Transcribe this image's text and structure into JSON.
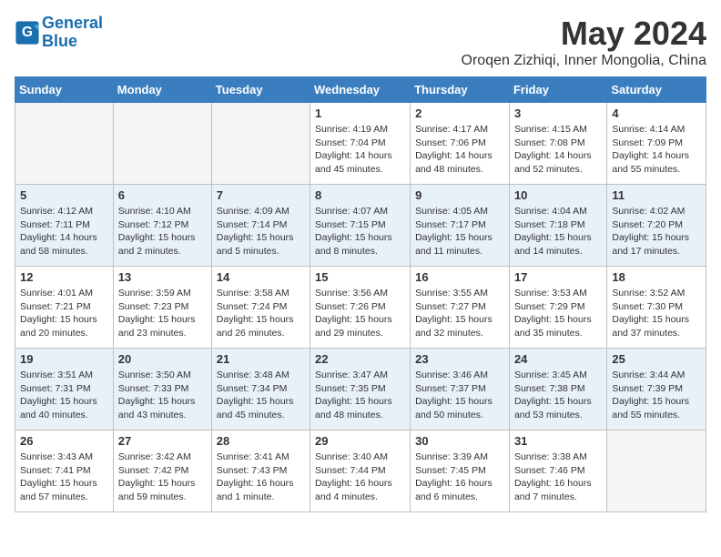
{
  "header": {
    "logo_line1": "General",
    "logo_line2": "Blue",
    "main_title": "May 2024",
    "subtitle": "Oroqen Zizhiqi, Inner Mongolia, China"
  },
  "days_of_week": [
    "Sunday",
    "Monday",
    "Tuesday",
    "Wednesday",
    "Thursday",
    "Friday",
    "Saturday"
  ],
  "weeks": [
    [
      {
        "day": "",
        "info": ""
      },
      {
        "day": "",
        "info": ""
      },
      {
        "day": "",
        "info": ""
      },
      {
        "day": "1",
        "info": "Sunrise: 4:19 AM\nSunset: 7:04 PM\nDaylight: 14 hours\nand 45 minutes."
      },
      {
        "day": "2",
        "info": "Sunrise: 4:17 AM\nSunset: 7:06 PM\nDaylight: 14 hours\nand 48 minutes."
      },
      {
        "day": "3",
        "info": "Sunrise: 4:15 AM\nSunset: 7:08 PM\nDaylight: 14 hours\nand 52 minutes."
      },
      {
        "day": "4",
        "info": "Sunrise: 4:14 AM\nSunset: 7:09 PM\nDaylight: 14 hours\nand 55 minutes."
      }
    ],
    [
      {
        "day": "5",
        "info": "Sunrise: 4:12 AM\nSunset: 7:11 PM\nDaylight: 14 hours\nand 58 minutes."
      },
      {
        "day": "6",
        "info": "Sunrise: 4:10 AM\nSunset: 7:12 PM\nDaylight: 15 hours\nand 2 minutes."
      },
      {
        "day": "7",
        "info": "Sunrise: 4:09 AM\nSunset: 7:14 PM\nDaylight: 15 hours\nand 5 minutes."
      },
      {
        "day": "8",
        "info": "Sunrise: 4:07 AM\nSunset: 7:15 PM\nDaylight: 15 hours\nand 8 minutes."
      },
      {
        "day": "9",
        "info": "Sunrise: 4:05 AM\nSunset: 7:17 PM\nDaylight: 15 hours\nand 11 minutes."
      },
      {
        "day": "10",
        "info": "Sunrise: 4:04 AM\nSunset: 7:18 PM\nDaylight: 15 hours\nand 14 minutes."
      },
      {
        "day": "11",
        "info": "Sunrise: 4:02 AM\nSunset: 7:20 PM\nDaylight: 15 hours\nand 17 minutes."
      }
    ],
    [
      {
        "day": "12",
        "info": "Sunrise: 4:01 AM\nSunset: 7:21 PM\nDaylight: 15 hours\nand 20 minutes."
      },
      {
        "day": "13",
        "info": "Sunrise: 3:59 AM\nSunset: 7:23 PM\nDaylight: 15 hours\nand 23 minutes."
      },
      {
        "day": "14",
        "info": "Sunrise: 3:58 AM\nSunset: 7:24 PM\nDaylight: 15 hours\nand 26 minutes."
      },
      {
        "day": "15",
        "info": "Sunrise: 3:56 AM\nSunset: 7:26 PM\nDaylight: 15 hours\nand 29 minutes."
      },
      {
        "day": "16",
        "info": "Sunrise: 3:55 AM\nSunset: 7:27 PM\nDaylight: 15 hours\nand 32 minutes."
      },
      {
        "day": "17",
        "info": "Sunrise: 3:53 AM\nSunset: 7:29 PM\nDaylight: 15 hours\nand 35 minutes."
      },
      {
        "day": "18",
        "info": "Sunrise: 3:52 AM\nSunset: 7:30 PM\nDaylight: 15 hours\nand 37 minutes."
      }
    ],
    [
      {
        "day": "19",
        "info": "Sunrise: 3:51 AM\nSunset: 7:31 PM\nDaylight: 15 hours\nand 40 minutes."
      },
      {
        "day": "20",
        "info": "Sunrise: 3:50 AM\nSunset: 7:33 PM\nDaylight: 15 hours\nand 43 minutes."
      },
      {
        "day": "21",
        "info": "Sunrise: 3:48 AM\nSunset: 7:34 PM\nDaylight: 15 hours\nand 45 minutes."
      },
      {
        "day": "22",
        "info": "Sunrise: 3:47 AM\nSunset: 7:35 PM\nDaylight: 15 hours\nand 48 minutes."
      },
      {
        "day": "23",
        "info": "Sunrise: 3:46 AM\nSunset: 7:37 PM\nDaylight: 15 hours\nand 50 minutes."
      },
      {
        "day": "24",
        "info": "Sunrise: 3:45 AM\nSunset: 7:38 PM\nDaylight: 15 hours\nand 53 minutes."
      },
      {
        "day": "25",
        "info": "Sunrise: 3:44 AM\nSunset: 7:39 PM\nDaylight: 15 hours\nand 55 minutes."
      }
    ],
    [
      {
        "day": "26",
        "info": "Sunrise: 3:43 AM\nSunset: 7:41 PM\nDaylight: 15 hours\nand 57 minutes."
      },
      {
        "day": "27",
        "info": "Sunrise: 3:42 AM\nSunset: 7:42 PM\nDaylight: 15 hours\nand 59 minutes."
      },
      {
        "day": "28",
        "info": "Sunrise: 3:41 AM\nSunset: 7:43 PM\nDaylight: 16 hours\nand 1 minute."
      },
      {
        "day": "29",
        "info": "Sunrise: 3:40 AM\nSunset: 7:44 PM\nDaylight: 16 hours\nand 4 minutes."
      },
      {
        "day": "30",
        "info": "Sunrise: 3:39 AM\nSunset: 7:45 PM\nDaylight: 16 hours\nand 6 minutes."
      },
      {
        "day": "31",
        "info": "Sunrise: 3:38 AM\nSunset: 7:46 PM\nDaylight: 16 hours\nand 7 minutes."
      },
      {
        "day": "",
        "info": ""
      }
    ]
  ]
}
